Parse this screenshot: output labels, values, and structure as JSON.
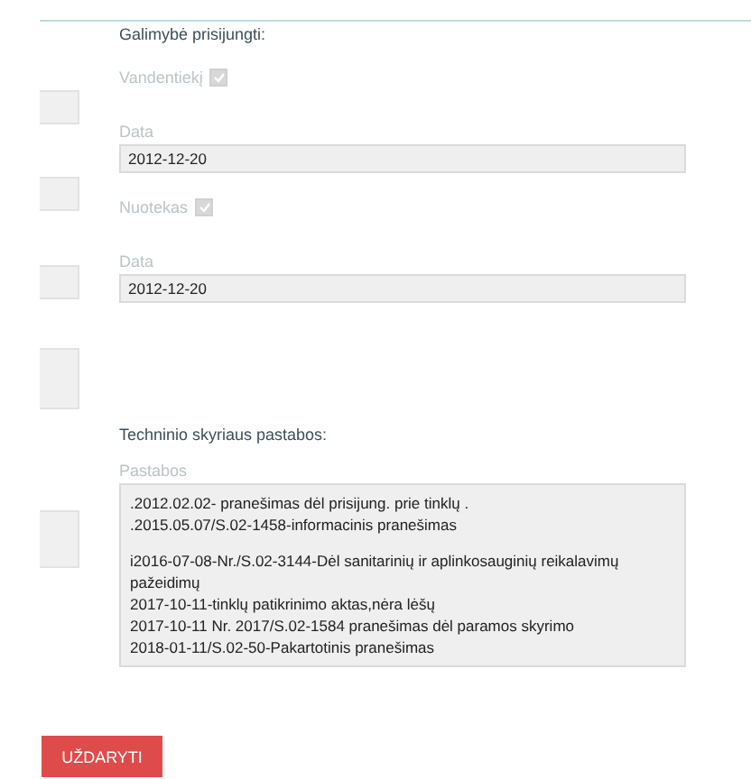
{
  "connection": {
    "heading": "Galimybė prisijungti:",
    "utilities": [
      {
        "label": "Vandentiekį",
        "checked": true,
        "date_label": "Data",
        "date": "2012-12-20"
      },
      {
        "label": "Nuotekas",
        "checked": true,
        "date_label": "Data",
        "date": "2012-12-20"
      }
    ]
  },
  "technical": {
    "heading": "Techninio skyriaus pastabos:",
    "notes_label": "Pastabos",
    "note_groups": [
      [
        ".2012.02.02- pranešimas dėl prisijung. prie tinklų .",
        ".2015.05.07/S.02-1458-informacinis pranešimas"
      ],
      [
        "i2016-07-08-Nr./S.02-3144-Dėl sanitarinių ir aplinkosauginių reikalavimų",
        "pažeidimų",
        "2017-10-11-tinklų patikrinimo aktas,nėra lėšų",
        "2017-10-11 Nr. 2017/S.02-1584 pranešimas dėl paramos skyrimo",
        "2018-01-11/S.02-50-Pakartotinis pranešimas"
      ]
    ]
  },
  "close_button": "UŽDARYTI"
}
